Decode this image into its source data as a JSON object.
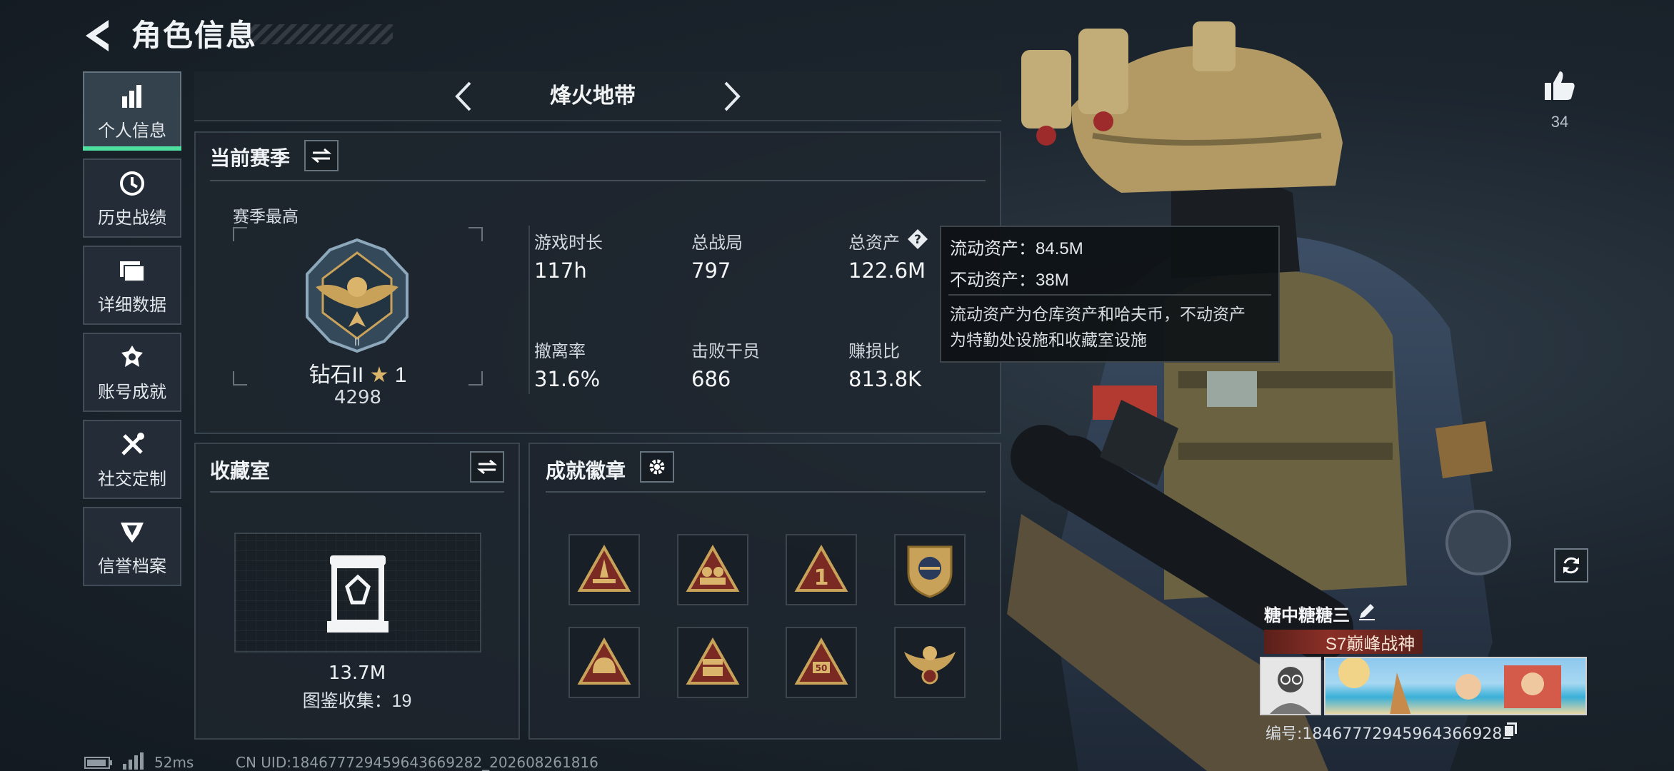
{
  "header": {
    "title": "角色信息"
  },
  "sidebar": {
    "items": [
      {
        "label": "个人信息",
        "icon": "bar-chart-icon",
        "active": true
      },
      {
        "label": "历史战绩",
        "icon": "history-clock-icon",
        "active": false
      },
      {
        "label": "详细数据",
        "icon": "folder-icon",
        "active": false
      },
      {
        "label": "账号成就",
        "icon": "medal-icon",
        "active": false
      },
      {
        "label": "社交定制",
        "icon": "tools-icon",
        "active": false
      },
      {
        "label": "信誉档案",
        "icon": "credit-emblem-icon",
        "active": false
      }
    ]
  },
  "mode": {
    "name": "烽火地带"
  },
  "season": {
    "title": "当前赛季",
    "best_label": "赛季最高",
    "rank_name": "钻石II",
    "rank_stars": "1",
    "rank_score": "4298",
    "stats": [
      {
        "label": "游戏时长",
        "value": "117h"
      },
      {
        "label": "总战局",
        "value": "797"
      },
      {
        "label": "总资产",
        "value": "122.6M"
      },
      {
        "label": "撤离率",
        "value": "31.6%"
      },
      {
        "label": "击败干员",
        "value": "686"
      },
      {
        "label": "赚损比",
        "value": "813.8K"
      }
    ]
  },
  "tooltip": {
    "liquid": "流动资产：84.5M",
    "fixed": "不动资产：38M",
    "desc_line1": "流动资产为仓库资产和哈夫币，不动资产",
    "desc_line2": "为特勤处设施和收藏室设施"
  },
  "collection": {
    "title": "收藏室",
    "value": "13.7M",
    "catalog": "图鉴收集：19"
  },
  "achievements": {
    "title": "成就徽章",
    "badges": [
      "rocket-badge-icon",
      "squad-badge-icon",
      "number-one-badge-icon",
      "shield-emblem-badge-icon",
      "helmet-badge-icon",
      "chest-badge-icon",
      "level-50-badge-icon",
      "eagle-badge-icon"
    ]
  },
  "profile": {
    "likes": "34",
    "name": "糖中糖糖三",
    "title_badge": "S7巅峰战神",
    "id_label": "编号:1846777294596436692​82"
  },
  "status_bar": {
    "ping": "52ms",
    "uid": "CN UID:1846777294596436692​82_202608261816"
  },
  "colors": {
    "accent": "#4fe0a0",
    "gold": "#c9a25a",
    "badge_red": "#7a2a22"
  }
}
